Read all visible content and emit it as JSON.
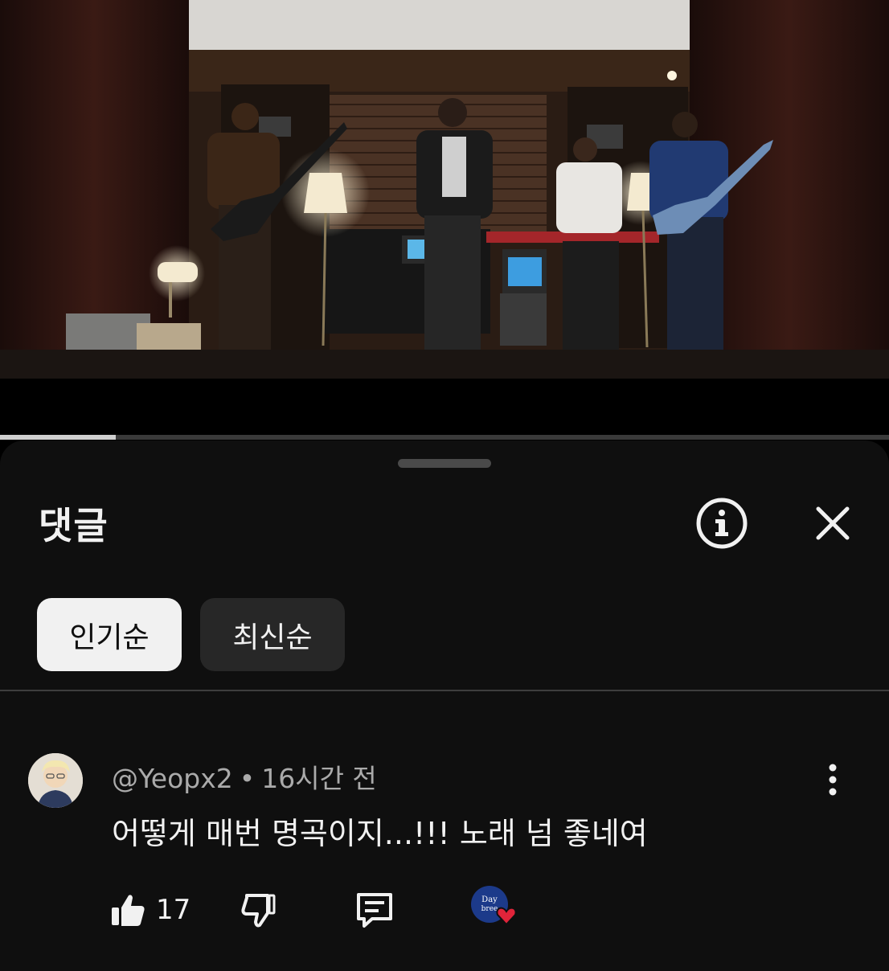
{
  "video": {
    "progress_fraction": 0.13
  },
  "comments_panel": {
    "title": "댓글",
    "info_icon": "info-icon",
    "close_icon": "close-icon",
    "sort_chips": [
      {
        "label": "인기순",
        "selected": true
      },
      {
        "label": "최신순",
        "selected": false
      }
    ]
  },
  "comment": {
    "author": "@Yeopx2",
    "separator": "•",
    "time": "16시간 전",
    "text": "어떻게 매번 명곡이지...!!! 노래 넘 좋네여",
    "like_count": "17",
    "creator_heart_badge": "Day breeze",
    "icons": {
      "like": "thumbs-up-icon",
      "dislike": "thumbs-down-icon",
      "reply": "reply-icon",
      "more": "more-vertical-icon",
      "heart": "heart-icon"
    }
  },
  "colors": {
    "sheet_bg": "#0f0f0f",
    "chip_active_bg": "#f1f1f1",
    "chip_inactive_bg": "#272727",
    "heart_red": "#e0243a",
    "badge_blue": "#1c3a8a"
  }
}
